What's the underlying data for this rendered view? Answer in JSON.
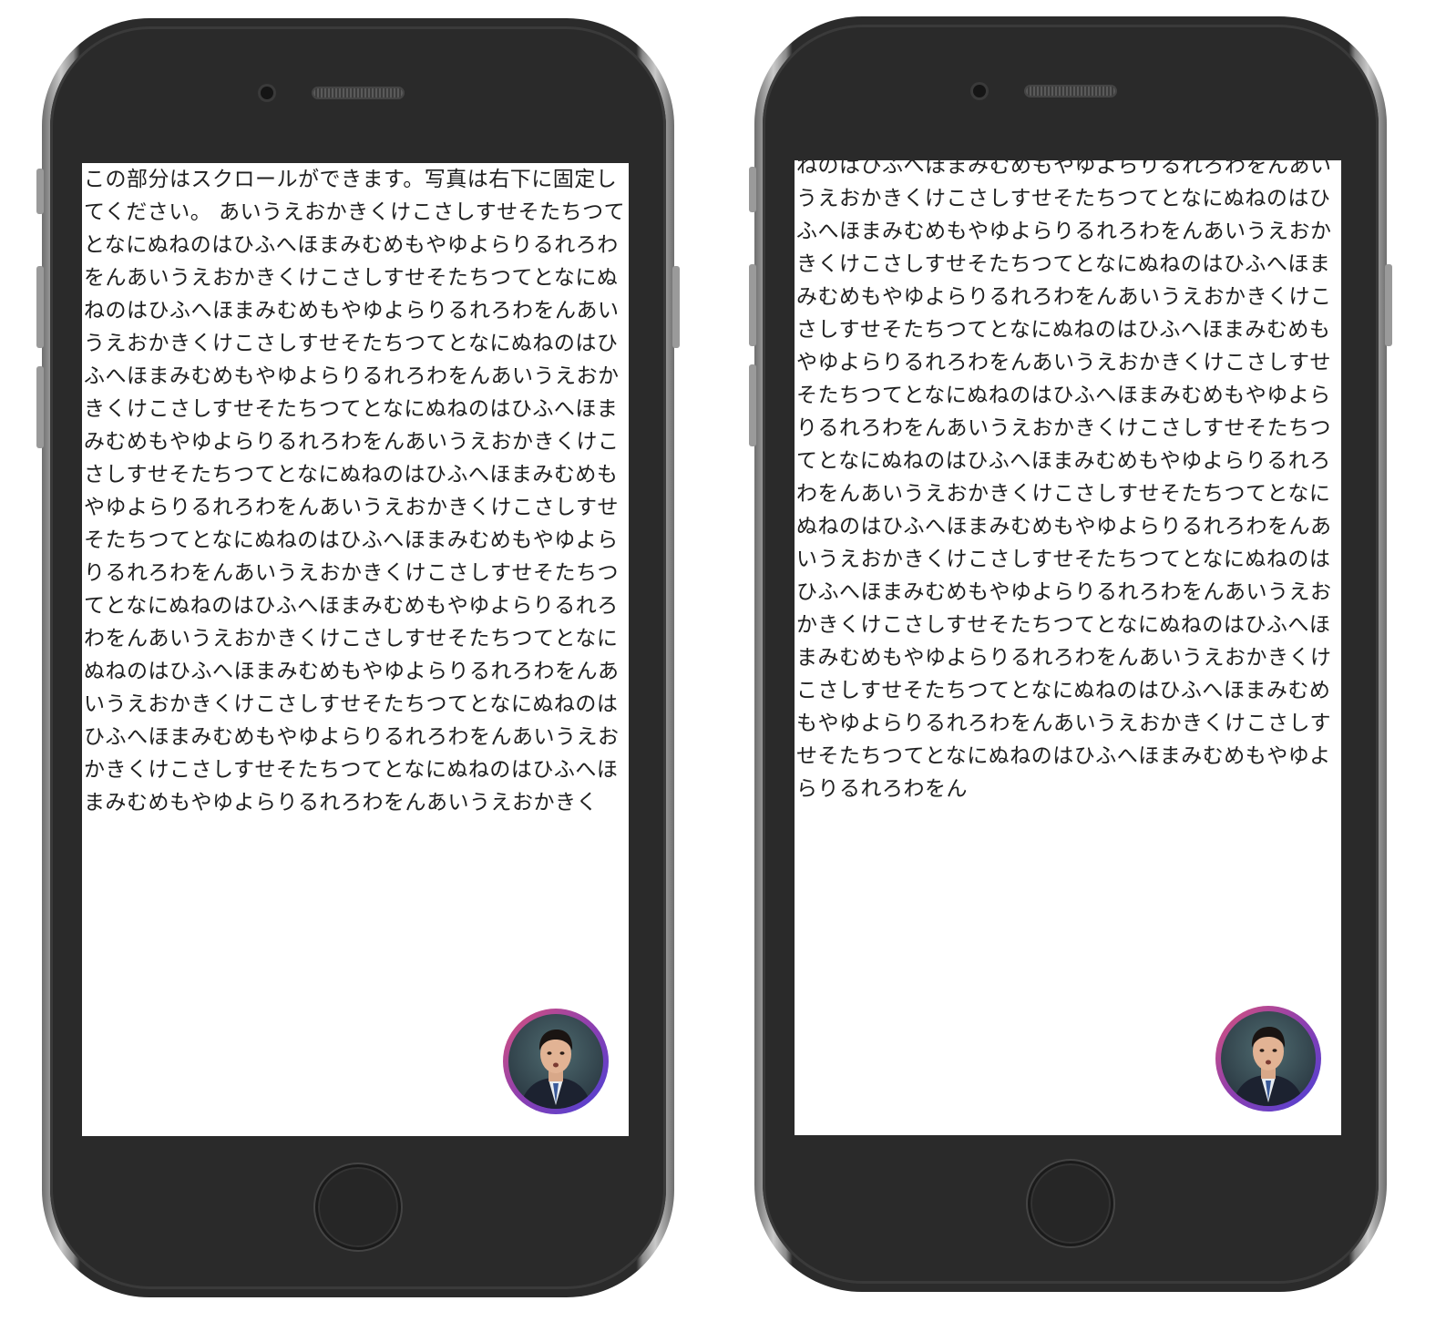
{
  "left_phone": {
    "screen_text": "この部分はスクロールができます。写真は右下に固定してください。 あいうえおかきくけこさしすせそたちつてとなにぬねのはひふへほまみむめもやゆよらりるれろわをんあいうえおかきくけこさしすせそたちつてとなにぬねのはひふへほまみむめもやゆよらりるれろわをんあいうえおかきくけこさしすせそたちつてとなにぬねのはひふへほまみむめもやゆよらりるれろわをんあいうえおかきくけこさしすせそたちつてとなにぬねのはひふへほまみむめもやゆよらりるれろわをんあいうえおかきくけこさしすせそたちつてとなにぬねのはひふへほまみむめもやゆよらりるれろわをんあいうえおかきくけこさしすせそたちつてとなにぬねのはひふへほまみむめもやゆよらりるれろわをんあいうえおかきくけこさしすせそたちつてとなにぬねのはひふへほまみむめもやゆよらりるれろわをんあいうえおかきくけこさしすせそたちつてとなにぬねのはひふへほまみむめもやゆよらりるれろわをんあいうえおかきくけこさしすせそたちつてとなにぬねのはひふへほまみむめもやゆよらりるれろわをんあいうえおかきくけこさしすせそたちつてとなにぬねのはひふへほまみむめもやゆよらりるれろわをんあいうえおかきく"
  },
  "right_phone": {
    "screen_text": "ねのはひふへほまみむめもやゆよらりるれろわをんあいうえおかきくけこさしすせそたちつてとなにぬねのはひふへほまみむめもやゆよらりるれろわをんあいうえおかきくけこさしすせそたちつてとなにぬねのはひふへほまみむめもやゆよらりるれろわをんあいうえおかきくけこさしすせそたちつてとなにぬねのはひふへほまみむめもやゆよらりるれろわをんあいうえおかきくけこさしすせそたちつてとなにぬねのはひふへほまみむめもやゆよらりるれろわをんあいうえおかきくけこさしすせそたちつてとなにぬねのはひふへほまみむめもやゆよらりるれろわをんあいうえおかきくけこさしすせそたちつてとなにぬねのはひふへほまみむめもやゆよらりるれろわをんあいうえおかきくけこさしすせそたちつてとなにぬねのはひふへほまみむめもやゆよらりるれろわをんあいうえおかきくけこさしすせそたちつてとなにぬねのはひふへほまみむめもやゆよらりるれろわをんあいうえおかきくけこさしすせそたちつてとなにぬねのはひふへほまみむめもやゆよらりるれろわをんあいうえおかきくけこさしすせそたちつてとなにぬねのはひふへほまみむめもやゆよらりるれろわをん"
  },
  "colors": {
    "phone_body": "#2a2a2a",
    "phone_frame": "#c9c9c9",
    "screen_bg": "#ffffff",
    "text": "#1f1f1f",
    "avatar_ring_start": "#d9527a",
    "avatar_ring_end": "#4a40d6"
  },
  "icons": {
    "avatar": "avatar-photo-icon",
    "home": "home-button-icon",
    "camera": "front-camera-icon",
    "speaker": "earpiece-speaker-icon"
  }
}
